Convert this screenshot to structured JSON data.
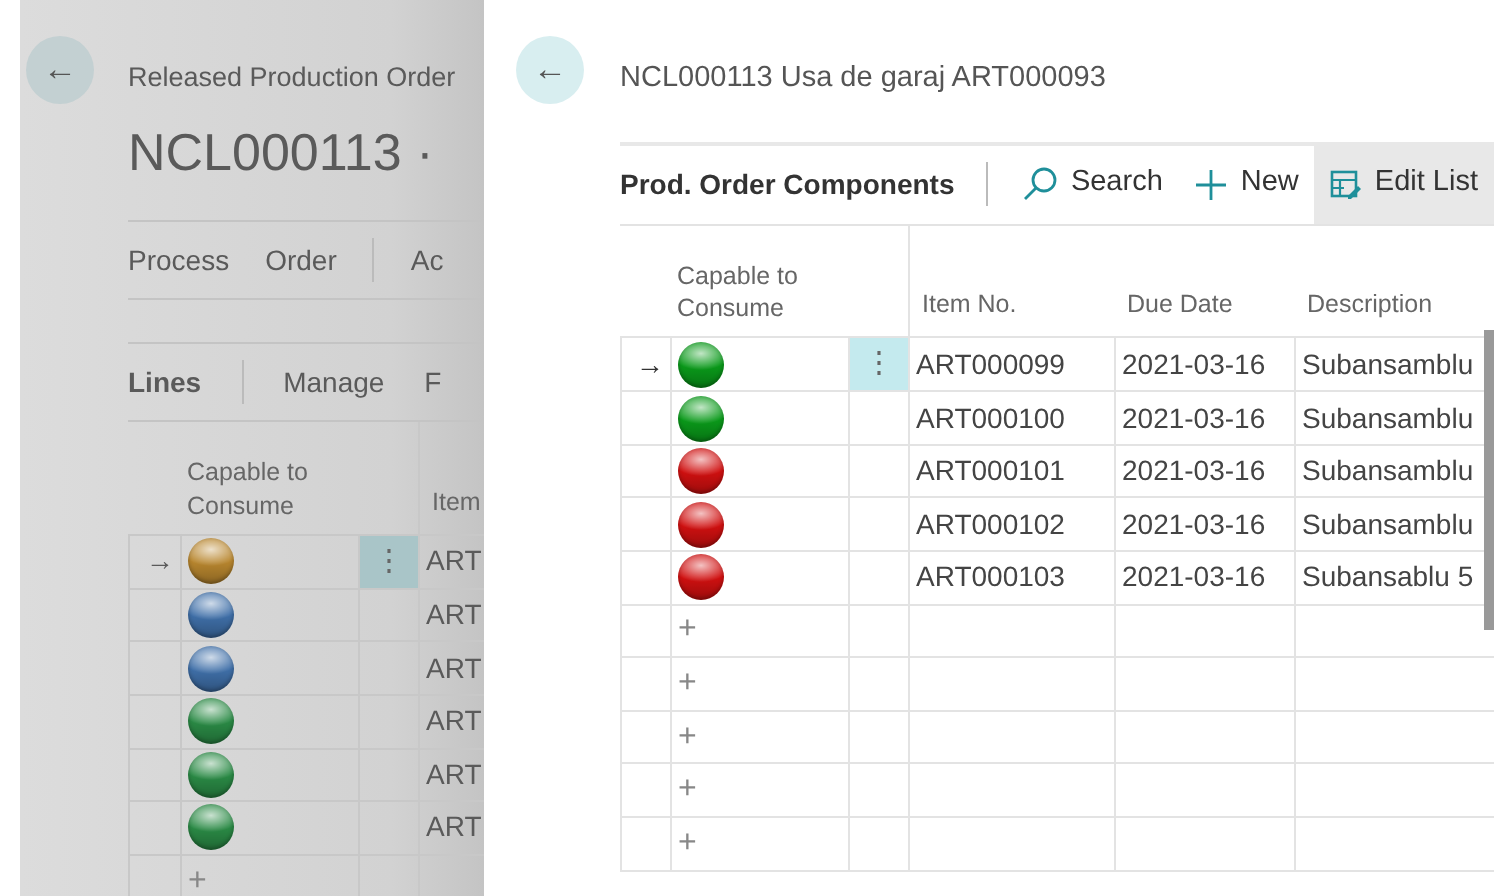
{
  "back_page": {
    "back_button": "←",
    "caption": "Released Production Order",
    "title": "NCL000113 ·",
    "actions": [
      "Process",
      "Order",
      "Ac"
    ],
    "lines_tabs": [
      "Lines",
      "Manage",
      "F"
    ],
    "columns": [
      "Capable to Consume",
      "Item"
    ],
    "rows": [
      {
        "selected": true,
        "arrow": "→",
        "menu": "⋮",
        "color": "#b8862e",
        "item": "ART"
      },
      {
        "selected": false,
        "color": "#3f6fa8",
        "item": "ART"
      },
      {
        "selected": false,
        "color": "#3f6fa8",
        "item": "ART"
      },
      {
        "selected": false,
        "color": "#2a8a45",
        "item": "ART"
      },
      {
        "selected": false,
        "color": "#2a8a45",
        "item": "ART"
      },
      {
        "selected": false,
        "color": "#2a8a45",
        "item": "ART"
      }
    ],
    "new_rows": [
      "+"
    ]
  },
  "panel": {
    "back_button": "←",
    "title": "NCL000113 Usa de garaj ART000093",
    "toolbar": {
      "heading": "Prod. Order Components",
      "actions": [
        {
          "kind": "search",
          "label": "Search"
        },
        {
          "kind": "new",
          "label": "New"
        },
        {
          "kind": "edit",
          "label": "Edit List"
        }
      ]
    },
    "columns": [
      "Capable to Consume",
      "Item No.",
      "Due Date",
      "Description"
    ],
    "rows": [
      {
        "selected": true,
        "arrow": "→",
        "menu": "⋮",
        "color": "#0a9a1a",
        "item_no": "ART000099",
        "due_date": "2021-03-16",
        "description": "Subansamblu"
      },
      {
        "selected": false,
        "color": "#0a9a1a",
        "item_no": "ART000100",
        "due_date": "2021-03-16",
        "description": "Subansamblu"
      },
      {
        "selected": false,
        "color": "#d01010",
        "item_no": "ART000101",
        "due_date": "2021-03-16",
        "description": "Subansamblu"
      },
      {
        "selected": false,
        "color": "#d01010",
        "item_no": "ART000102",
        "due_date": "2021-03-16",
        "description": "Subansamblu"
      },
      {
        "selected": false,
        "color": "#d01010",
        "item_no": "ART000103",
        "due_date": "2021-03-16",
        "description": "Subansablu 5"
      }
    ],
    "new_rows": [
      "+",
      "+",
      "+",
      "+",
      "+"
    ]
  }
}
